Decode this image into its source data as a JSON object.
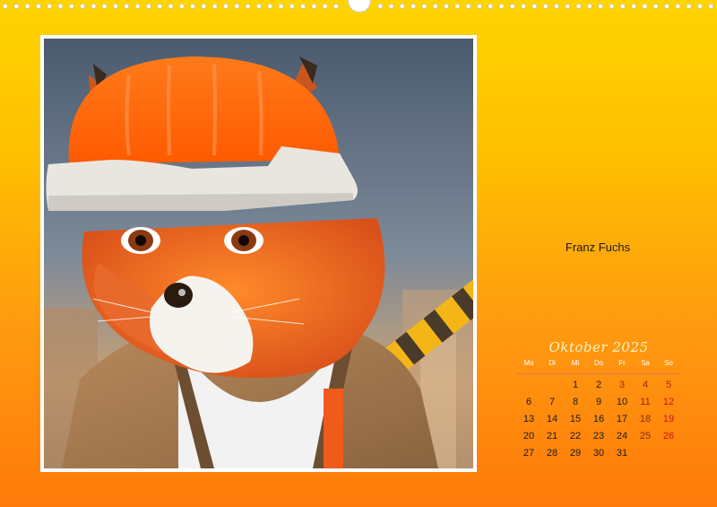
{
  "caption": "Franz Fuchs",
  "calendar": {
    "title": "Oktober 2025",
    "weekdays": [
      "Mo",
      "Di",
      "Mi",
      "Do",
      "Fr",
      "Sa",
      "So"
    ],
    "leading_blanks": 2,
    "days": [
      "1",
      "2",
      "3",
      "4",
      "5",
      "6",
      "7",
      "8",
      "9",
      "10",
      "11",
      "12",
      "13",
      "14",
      "15",
      "16",
      "17",
      "18",
      "19",
      "20",
      "21",
      "22",
      "23",
      "24",
      "25",
      "26",
      "27",
      "28",
      "29",
      "30",
      "31"
    ],
    "holidays": [
      "3"
    ]
  },
  "colors": {
    "background_top": "#ffd400",
    "background_bottom": "#ff7a0a",
    "sunday": "#c21818",
    "saturday": "#8a2a10"
  },
  "photo": {
    "subject": "fox-with-hard-hat"
  }
}
